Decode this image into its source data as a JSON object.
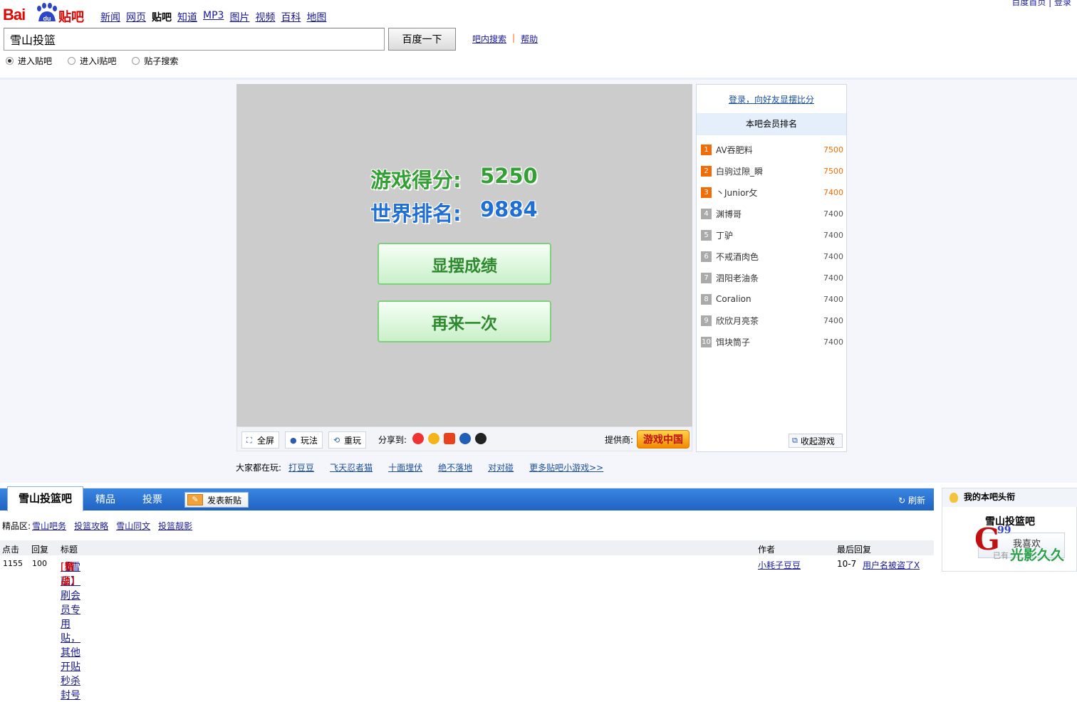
{
  "header": {
    "logo_text_bai": "Bai",
    "logo_text_du": "du",
    "logo_text_tieba": "贴吧",
    "nav": [
      "新闻",
      "网页",
      "贴吧",
      "知道",
      "MP3",
      "图片",
      "视频",
      "百科",
      "地图"
    ],
    "nav_active_index": 2,
    "top_links": "百度首页 | 登录",
    "search_value": "雪山投篮",
    "search_button": "百度一下",
    "search_links": [
      "吧内搜索",
      "帮助"
    ],
    "search_sep": "|",
    "radios": [
      {
        "label": "进入贴吧",
        "checked": true
      },
      {
        "label": "进入i贴吧",
        "checked": false
      },
      {
        "label": "贴子搜索",
        "checked": false
      }
    ]
  },
  "game": {
    "score_label": "游戏得分:",
    "score_value": "5250",
    "rank_label": "世界排名:",
    "rank_value": "9884",
    "show_button": "显摆成绩",
    "again_button": "再来一次",
    "toolbar": {
      "fullscreen": "全屏",
      "howto": "玩法",
      "replay": "重玩",
      "share_label": "分享到:",
      "provider_label": "提供商:",
      "provider_logo": "游戏中国"
    },
    "playing_label": "大家都在玩:",
    "playing_links": [
      "打豆豆",
      "飞天忍者猫",
      "十面埋伏",
      "绝不落地",
      "对对碰",
      "更多贴吧小游戏>>"
    ]
  },
  "rank_panel": {
    "login_link": "登录，向好友显摆比分",
    "title": "本吧会员排名",
    "rows": [
      {
        "num": "1",
        "name": "AV吞肥料",
        "score": "7500",
        "top": true
      },
      {
        "num": "2",
        "name": "白驹过隙_瞬",
        "score": "7500",
        "top": true
      },
      {
        "num": "3",
        "name": "丶Junior攵",
        "score": "7400",
        "top": true
      },
      {
        "num": "4",
        "name": "渊博哥",
        "score": "7400",
        "top": false
      },
      {
        "num": "5",
        "name": "丁驴",
        "score": "7400",
        "top": false
      },
      {
        "num": "6",
        "name": "不戒酒肉色",
        "score": "7400",
        "top": false
      },
      {
        "num": "7",
        "name": "泗阳老油条",
        "score": "7400",
        "top": false
      },
      {
        "num": "8",
        "name": "Coralion",
        "score": "7400",
        "top": false
      },
      {
        "num": "9",
        "name": "欣欣月亮茶",
        "score": "7400",
        "top": false
      },
      {
        "num": "10",
        "name": "饵块筒子",
        "score": "7400",
        "top": false
      }
    ],
    "collapse_button": "收起游戏"
  },
  "forum": {
    "tab_home": "雪山投篮吧",
    "tab_jingpin": "精品",
    "tab_vote": "投票",
    "post_button": "发表新贴",
    "refresh": "刷新",
    "jingpin_label": "精品区:",
    "jingpin_links": [
      "雪山吧务",
      "投篮攻略",
      "雪山同文",
      "投篮靓影"
    ],
    "columns": {
      "clicks": "点击",
      "replies": "回复",
      "title": "标题",
      "author": "作者",
      "last_reply": "最后回复"
    },
    "thread": {
      "clicks": "1155",
      "replies": "100",
      "title": "【雪山】刷会员专用贴，其他开贴秒杀封号",
      "tag1": "[精品]",
      "tag2": "[置顶]",
      "author": "小耗子豆豆",
      "last_date": "10-7",
      "last_user": "用户名被盗了X"
    }
  },
  "mybar": {
    "title": "我的本吧头衔",
    "bar_name": "雪山投篮吧",
    "like_button": "我喜欢",
    "like_sub": "已有"
  },
  "watermark": {
    "big": "G",
    "small": "99",
    "text": "光影久久"
  },
  "colors": {
    "brand_red": "#e10602",
    "tab_blue": "#1f63c3",
    "score_green": "#33a033",
    "rank_blue": "#1f6fd6",
    "rank_orange": "#f26b06",
    "rank_gray": "#aaaaaa"
  }
}
